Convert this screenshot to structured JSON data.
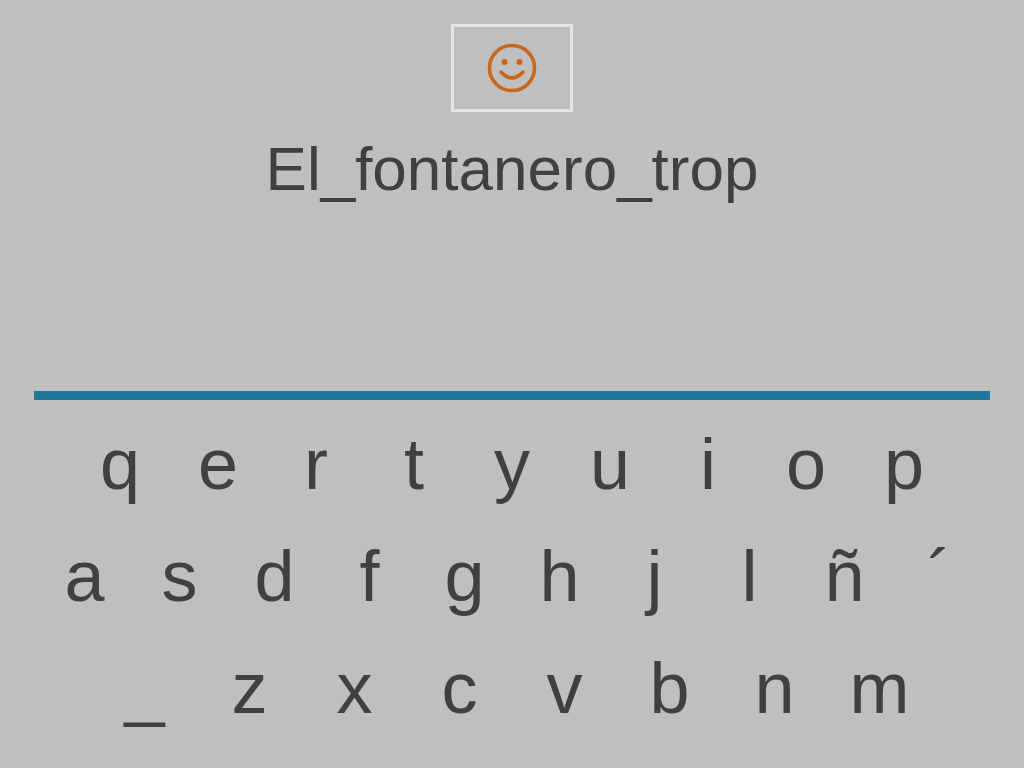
{
  "word": "El_fontanero_trop",
  "keyboard": {
    "rows": [
      {
        "keys": [
          "q",
          "e",
          "r",
          "t",
          "y",
          "u",
          "i",
          "o",
          "p"
        ]
      },
      {
        "keys": [
          "a",
          "s",
          "d",
          "f",
          "g",
          "h",
          "j",
          "l",
          "ñ",
          "´"
        ]
      },
      {
        "keys": [
          "_",
          "z",
          "x",
          "c",
          "v",
          "b",
          "n",
          "m"
        ]
      }
    ]
  }
}
